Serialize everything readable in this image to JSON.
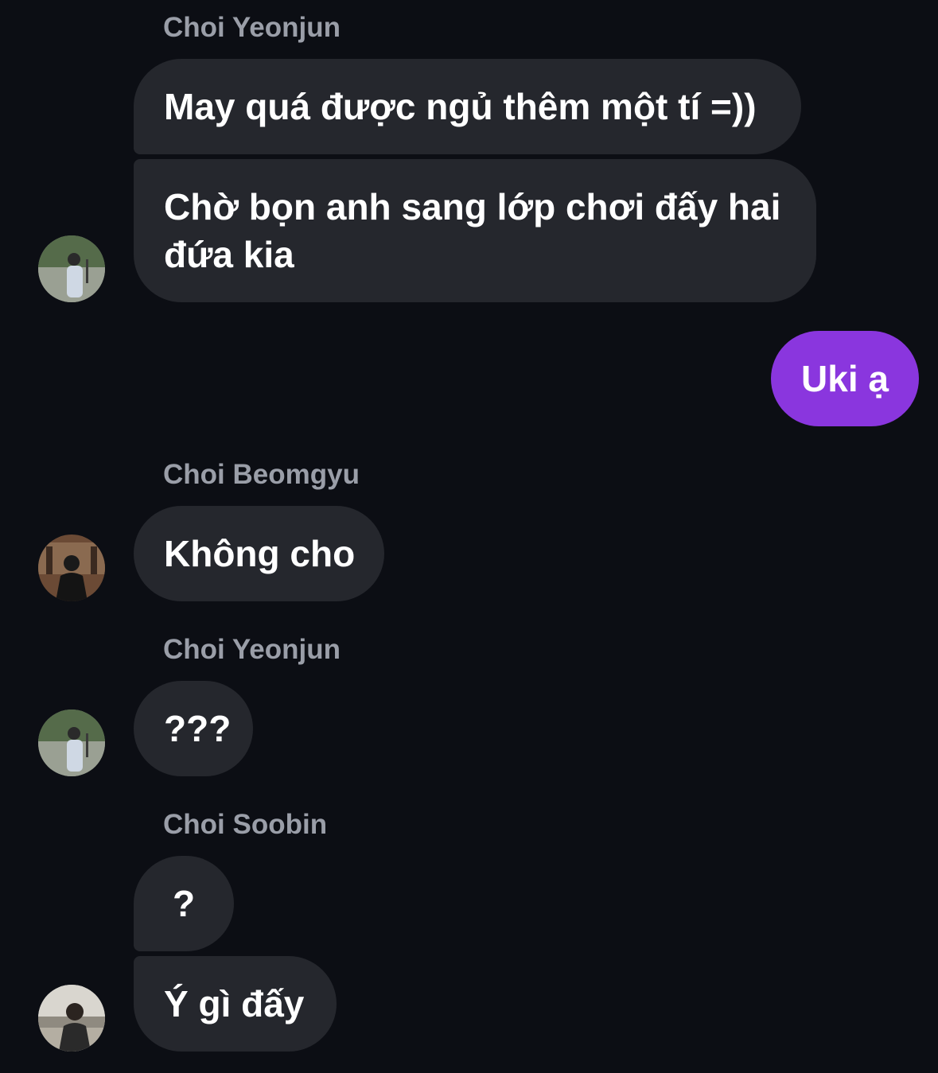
{
  "messages": [
    {
      "type": "sender",
      "name": "Choi Yeonjun"
    },
    {
      "type": "incoming",
      "text": "May quá được ngủ thêm một tí =))"
    },
    {
      "type": "incoming",
      "text": "Chờ bọn anh sang lớp chơi đấy hai đứa kia"
    },
    {
      "type": "outgoing",
      "text": "Uki ạ"
    },
    {
      "type": "sender",
      "name": "Choi Beomgyu"
    },
    {
      "type": "incoming",
      "text": "Không cho"
    },
    {
      "type": "sender",
      "name": "Choi Yeonjun"
    },
    {
      "type": "incoming",
      "text": "???"
    },
    {
      "type": "sender",
      "name": "Choi Soobin"
    },
    {
      "type": "incoming",
      "text": "?"
    },
    {
      "type": "incoming",
      "text": "Ý gì đấy"
    }
  ],
  "avatars": [
    {
      "icon": "yeonjun-avatar-photo",
      "owner": "Choi Yeonjun"
    },
    {
      "icon": "beomgyu-avatar-photo",
      "owner": "Choi Beomgyu"
    },
    {
      "icon": "yeonjun-avatar-photo",
      "owner": "Choi Yeonjun"
    },
    {
      "icon": "soobin-avatar-photo",
      "owner": "Choi Soobin"
    }
  ],
  "colors": {
    "background": "#0c0e14",
    "incoming_bubble": "#25272d",
    "outgoing_bubble": "#8a36de",
    "sender_name": "#9a9ea8",
    "text": "#ffffff"
  }
}
